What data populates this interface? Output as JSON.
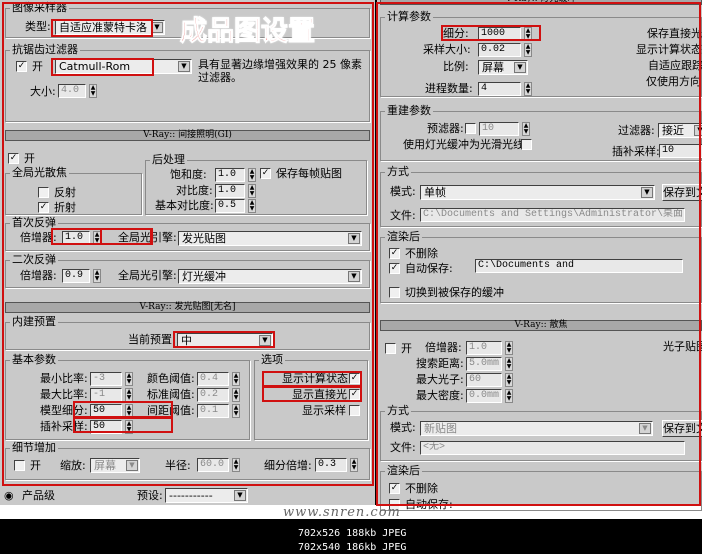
{
  "overlay_title": "成品图设置",
  "left": {
    "image_sampler": {
      "group": "图像采样器",
      "type_label": "类型:",
      "type_value": "自适应准蒙特卡洛"
    },
    "aa_filter": {
      "group": "抗锯齿过滤器",
      "on_label": "开",
      "on_checked": true,
      "filter_value": "Catmull-Rom",
      "description": "具有显著边缘增强效果的 25 像素过滤器。",
      "size_label": "大小:",
      "size_value": "4.0"
    },
    "gi": {
      "header": "V-Ray:: 间接照明(GI)",
      "on_label": "开",
      "on_checked": true,
      "caustics_group": "全局光散焦",
      "reflect_label": "反射",
      "reflect_checked": false,
      "refract_label": "折射",
      "refract_checked": true,
      "post_group": "后处理",
      "saturation_label": "饱和度:",
      "saturation_value": "1.0",
      "save_maps_label": "保存每帧贴图",
      "save_maps_checked": true,
      "contrast_label": "对比度:",
      "contrast_value": "1.0",
      "base_contrast_label": "基本对比度:",
      "base_contrast_value": "0.5",
      "primary_group": "首次反弹",
      "primary_mult_label": "倍增器:",
      "primary_mult_value": "1.0",
      "primary_engine_label": "全局光引擎:",
      "primary_engine_value": "发光贴图",
      "secondary_group": "二次反弹",
      "secondary_mult_label": "倍增器:",
      "secondary_mult_value": "0.9",
      "secondary_engine_label": "全局光引擎:",
      "secondary_engine_value": "灯光缓冲"
    },
    "irradiance": {
      "header": "V-Ray:: 发光贴图[无名]",
      "preset_group": "内建预置",
      "preset_label": "当前预置:",
      "preset_value": "中",
      "basic_group": "基本参数",
      "min_rate_label": "最小比率:",
      "min_rate_value": "-3",
      "color_thresh_label": "颜色阈值:",
      "color_thresh_value": "0.4",
      "max_rate_label": "最大比率:",
      "max_rate_value": "-1",
      "normal_thresh_label": "标准阈值:",
      "normal_thresh_value": "0.2",
      "hsph_label": "模型细分:",
      "hsph_value": "50",
      "dist_thresh_label": "间距阈值:",
      "dist_thresh_value": "0.1",
      "interp_label": "插补采样:",
      "interp_value": "50",
      "options_group": "选项",
      "show_calc_label": "显示计算状态",
      "show_calc_checked": true,
      "show_direct_label": "显示直接光",
      "show_direct_checked": true,
      "show_samples_label": "显示采样",
      "show_samples_checked": false,
      "detail_group": "细节增加",
      "detail_on_label": "开",
      "detail_on_checked": false,
      "scale_label": "缩放:",
      "scale_value": "屏幕",
      "radius_label": "半径:",
      "radius_value": "60.0",
      "subdiv_mult_label": "细分倍增:",
      "subdiv_mult_value": "0.3"
    },
    "bottom": {
      "production_label": "产品级",
      "production_selected": true,
      "preset_label": "预设:",
      "preset_value": "-----------"
    }
  },
  "right": {
    "light_cache": {
      "header": "V-Ray:: 灯光缓冲",
      "calc_group": "计算参数",
      "subdivs_label": "细分:",
      "subdivs_value": "1000",
      "sample_size_label": "采样大小:",
      "sample_size_value": "0.02",
      "scale_label": "比例:",
      "scale_value": "屏幕",
      "passes_label": "进程数量:",
      "passes_value": "4",
      "store_direct_label": "保存直接光",
      "show_calc_label": "显示计算状态",
      "adaptive_label": "自适应跟踪",
      "directions_label": "仅使用方向",
      "recon_group": "重建参数",
      "prefilter_label": "预滤器:",
      "prefilter_checked": false,
      "prefilter_value": "10",
      "use_glossy_label": "使用灯光缓冲为光滑光线",
      "use_glossy_checked": false,
      "filter_label": "过滤器:",
      "filter_value": "接近",
      "interp_label": "插补采样:",
      "interp_value": "10",
      "mode_group": "方式",
      "mode_label": "模式:",
      "mode_value": "单帧",
      "save_button": "保存到文件",
      "file_label": "文件:",
      "file_value": "C:\\Documents and Settings\\Administrator\\桌面\\1.vrlmap",
      "after_group": "渲染后",
      "no_delete_label": "不删除",
      "no_delete_checked": true,
      "autosave_label": "自动保存:",
      "autosave_checked": true,
      "autosave_value": "C:\\Documents and",
      "switch_label": "切换到被保存的缓冲",
      "switch_checked": false
    },
    "caustics": {
      "header": "V-Ray:: 散焦",
      "on_label": "开",
      "on_checked": false,
      "mult_label": "倍增器:",
      "mult_value": "1.0",
      "search_label": "搜索距离:",
      "search_value": "5.0mm",
      "max_photons_label": "最大光子:",
      "max_photons_value": "60",
      "max_density_label": "最大密度:",
      "max_density_value": "0.0mm",
      "photon_map_label": "光子贴图",
      "mode_group": "方式",
      "mode_label": "模式:",
      "mode_value": "新贴图",
      "save_button": "保存到文件",
      "file_label": "文件:",
      "file_value": "<无>",
      "after_group": "渲染后",
      "no_delete_label": "不删除",
      "no_delete_checked": true,
      "autosave_label": "自动保存:"
    }
  },
  "watermark": "www.snren.com",
  "image_info": [
    "702x526 188kb JPEG",
    "702x540 186kb JPEG"
  ],
  "colors": {
    "highlight_red": "#d01010",
    "panel_gray": "#c9c9c9"
  }
}
